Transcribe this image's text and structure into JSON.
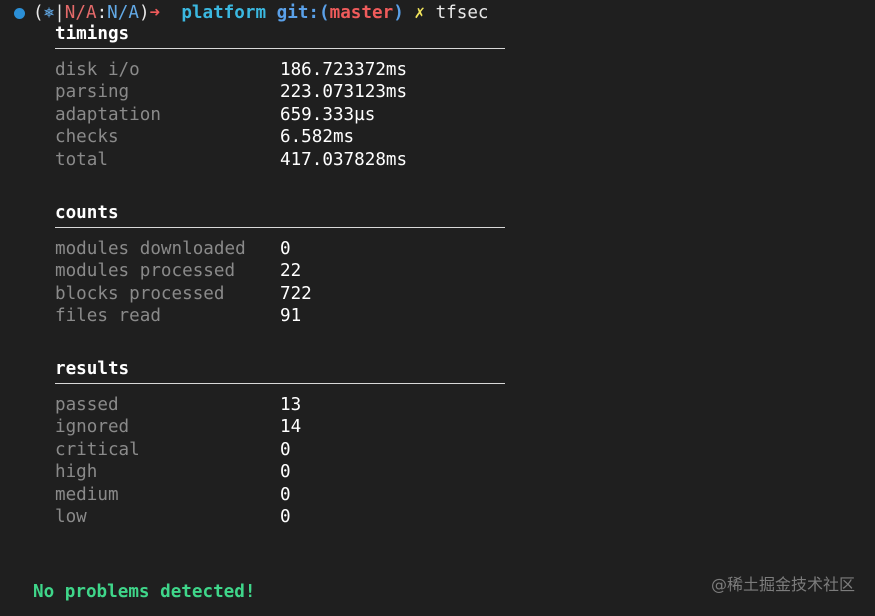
{
  "prompt": {
    "dot_color": "#2b8fd6",
    "open_paren": "(",
    "kube_icon": "⎈",
    "bar": "|",
    "context": "N/A",
    "colon": ":",
    "namespace": "N/A",
    "close_paren": ")",
    "arrow": "➜",
    "directory": "platform",
    "git_label": "git:",
    "git_open": "(",
    "branch": "master",
    "git_close": ")",
    "dirty_mark": "✗",
    "command": "tfsec"
  },
  "sections": {
    "timings": {
      "title": "timings",
      "rows": [
        {
          "key": "disk i/o",
          "value": "186.723372ms"
        },
        {
          "key": "parsing",
          "value": "223.073123ms"
        },
        {
          "key": "adaptation",
          "value": "659.333µs"
        },
        {
          "key": "checks",
          "value": "6.582ms"
        },
        {
          "key": "total",
          "value": "417.037828ms"
        }
      ]
    },
    "counts": {
      "title": "counts",
      "rows": [
        {
          "key": "modules downloaded",
          "value": "0"
        },
        {
          "key": "modules processed",
          "value": "22"
        },
        {
          "key": "blocks processed",
          "value": "722"
        },
        {
          "key": "files read",
          "value": "91"
        }
      ]
    },
    "results": {
      "title": "results",
      "rows": [
        {
          "key": "passed",
          "value": "13"
        },
        {
          "key": "ignored",
          "value": "14"
        },
        {
          "key": "critical",
          "value": "0"
        },
        {
          "key": "high",
          "value": "0"
        },
        {
          "key": "medium",
          "value": "0"
        },
        {
          "key": "low",
          "value": "0"
        }
      ]
    }
  },
  "status_message": "No problems detected!",
  "watermark": "@稀土掘金技术社区"
}
